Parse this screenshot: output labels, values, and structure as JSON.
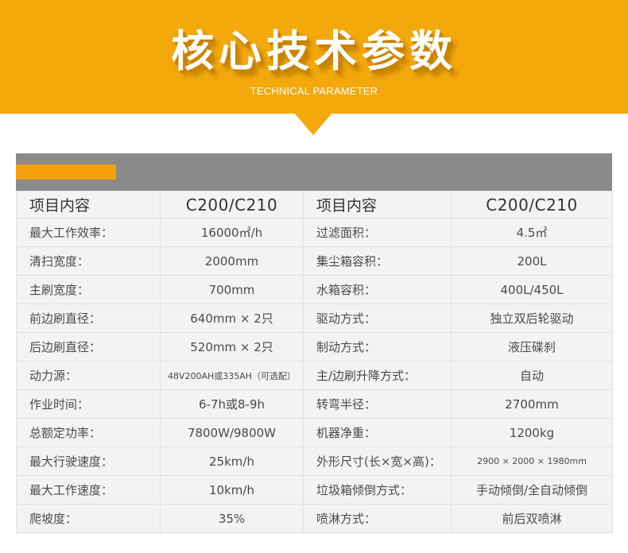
{
  "banner": {
    "title": "核心技术参数",
    "subtitle": "TECHNICAL PARAMETER",
    "color": "#f3a80b"
  },
  "table": {
    "header": {
      "item_label_1": "项目内容",
      "model_1": "C200/C210",
      "item_label_2": "项目内容",
      "model_2": "C200/C210"
    },
    "rows": [
      {
        "label1": "最大工作效率：",
        "value1": "16000㎡/h",
        "label2": "过滤面积：",
        "value2": "4.5㎡"
      },
      {
        "label1": "清扫宽度：",
        "value1": "2000mm",
        "label2": "集尘箱容积：",
        "value2": "200L"
      },
      {
        "label1": "主刷宽度：",
        "value1": "700mm",
        "label2": "水箱容积：",
        "value2": "400L/450L"
      },
      {
        "label1": "前边刷直径：",
        "value1": "640mm × 2只",
        "label2": "驱动方式：",
        "value2": "独立双后轮驱动"
      },
      {
        "label1": "后边刷直径：",
        "value1": "520mm × 2只",
        "label2": "制动方式：",
        "value2": "液压碟刹"
      },
      {
        "label1": "动力源：",
        "value1": "48V200AH或335AH（可选配）",
        "label2": "主/边刷升降方式：",
        "value2": "自动"
      },
      {
        "label1": "作业时间：",
        "value1": "6-7h或8-9h",
        "label2": "转弯半径：",
        "value2": "2700mm"
      },
      {
        "label1": "总额定功率：",
        "value1": "7800W/9800W",
        "label2": "机器净重：",
        "value2": "1200kg"
      },
      {
        "label1": "最大行驶速度：",
        "value1": "25km/h",
        "label2": "外形尺寸(长×宽×高)：",
        "value2": "2900 × 2000 × 1980mm"
      },
      {
        "label1": "最大工作速度：",
        "value1": "10km/h",
        "label2": "垃圾箱倾倒方式：",
        "value2": "手动倾倒/全自动倾倒"
      },
      {
        "label1": "爬坡度：",
        "value1": "35%",
        "label2": "喷淋方式：",
        "value2": "前后双喷淋"
      }
    ]
  }
}
